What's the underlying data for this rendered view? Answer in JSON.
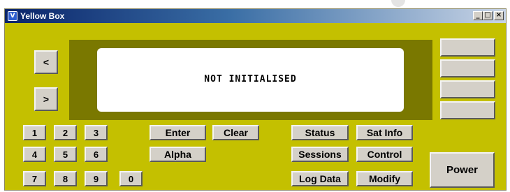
{
  "window": {
    "title": "Yellow Box",
    "app_icon": "V",
    "minimize": "_",
    "maximize": "□",
    "close": "×"
  },
  "display": {
    "text": "NOT INITIALISED"
  },
  "nav": {
    "prev": "<",
    "next": ">"
  },
  "numpad": [
    "1",
    "2",
    "3",
    "4",
    "5",
    "6",
    "7",
    "8",
    "9",
    "0"
  ],
  "actions": {
    "enter": "Enter",
    "clear": "Clear",
    "alpha": "Alpha"
  },
  "functions": {
    "status": "Status",
    "sat_info": "Sat Info",
    "sessions": "Sessions",
    "control": "Control",
    "log_data": "Log Data",
    "modify": "Modify"
  },
  "power": "Power"
}
